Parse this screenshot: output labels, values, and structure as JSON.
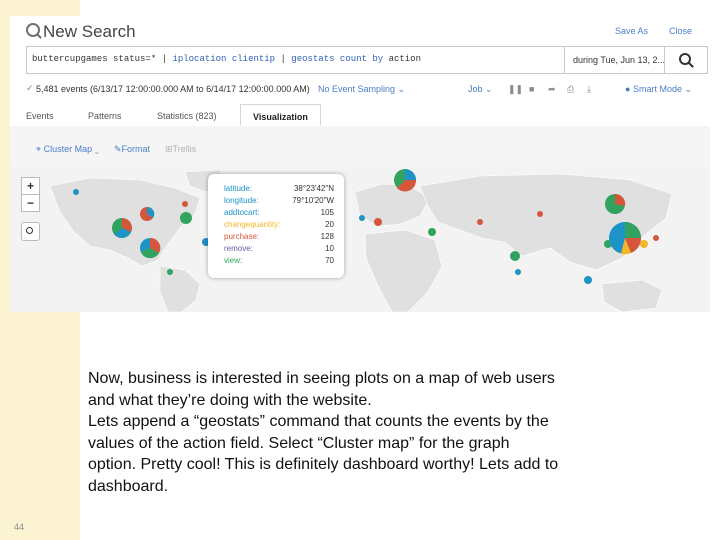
{
  "slide": {
    "number": "44"
  },
  "app": {
    "title": "New Search",
    "save_as": "Save As",
    "close": "Close",
    "query_parts": [
      "buttercupgames status=*",
      "|",
      "iplocation clientip",
      "|",
      "geostats",
      "count",
      "by",
      "action"
    ],
    "time_range": "during Tue, Jun 13, 2...",
    "status": {
      "events": "5,481 events (6/13/17 12:00:00.000 AM to 6/14/17 12:00:00.000 AM)",
      "sampling": "No Event Sampling",
      "job": "Job",
      "smart_mode": "Smart Mode"
    },
    "tabs": [
      "Events",
      "Patterns",
      "Statistics (823)",
      "Visualization"
    ],
    "active_tab": "Visualization",
    "viz_options": [
      "Cluster Map",
      "Format",
      "Trellis"
    ],
    "map": {
      "zoom_in": "+",
      "zoom_out": "−",
      "popup": [
        {
          "key": "latitude:",
          "value": "38°23'42\"N"
        },
        {
          "key": "longitude:",
          "value": "79°10'20\"W"
        },
        {
          "key": "addtocart:",
          "value": "105"
        },
        {
          "key": "changequantity:",
          "value": "20"
        },
        {
          "key": "purchase:",
          "value": "128"
        },
        {
          "key": "remove:",
          "value": "10"
        },
        {
          "key": "view:",
          "value": "70"
        }
      ]
    }
  },
  "description": {
    "lines": [
      "Now, business is interested in seeing plots on a map of web users",
      "and what they’re doing with the website.",
      "Lets append a “geostats” command that counts the events by the",
      "values of the action field. Select “Cluster map” for the graph",
      "option. Pretty cool! This is definitely dashboard worthy! Lets add to",
      "dashboard."
    ]
  },
  "colors": {
    "accent": "#4a7fc8",
    "addtocart": "#1e93c6",
    "changequantity": "#f2b827",
    "purchase": "#d6563c",
    "remove": "#6a5c9e",
    "view": "#31a35f",
    "slide_strip": "#fbf3d2"
  }
}
